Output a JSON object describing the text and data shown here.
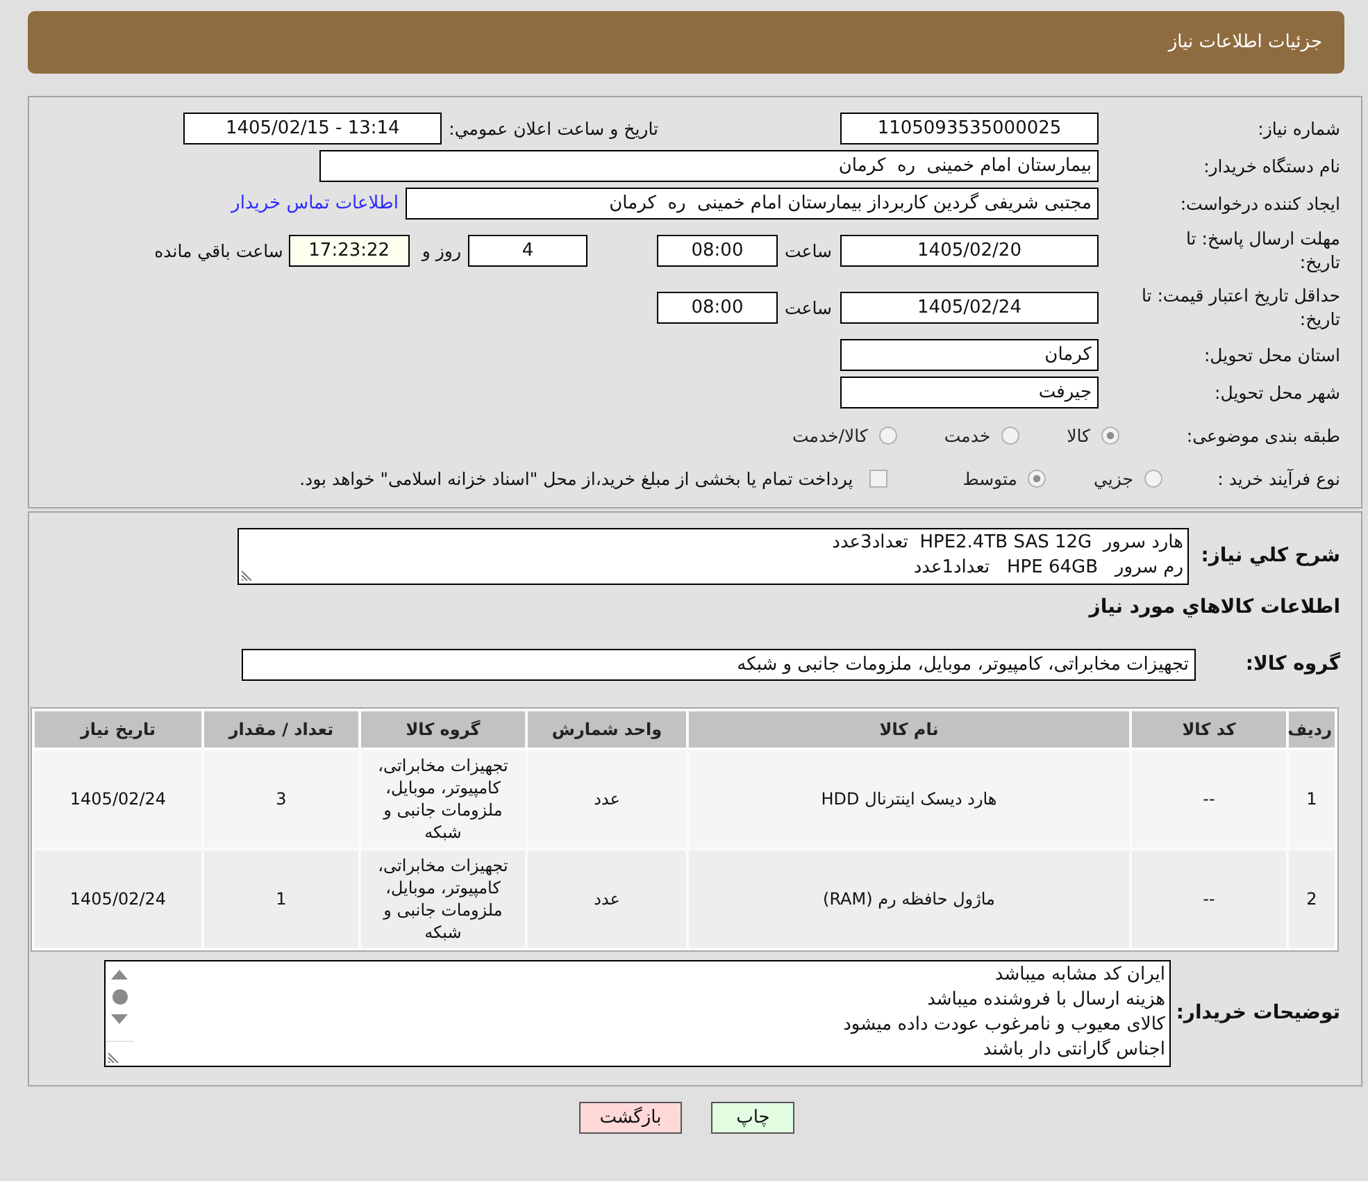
{
  "header": {
    "title": "جزئیات اطلاعات نیاز"
  },
  "details": {
    "need_number": {
      "label": "شماره نیاز:",
      "value": "1105093535000025"
    },
    "announcement": {
      "label": "تاریخ و ساعت اعلان عمومي:",
      "value": "1405/02/15 - 13:14"
    },
    "buyer_organization": {
      "label": "نام دستگاه خریدار:",
      "value": "بیمارستان امام خمینی  ره  کرمان"
    },
    "requester": {
      "label": "ایجاد کننده درخواست:",
      "value": "مجتبی شریفی گردین کاربرداز بیمارستان امام خمینی  ره  کرمان",
      "contact_link": "اطلاعات تماس خریدار"
    },
    "reply_deadline": {
      "label": "مهلت ارسال پاسخ: تا تاریخ:",
      "date": "1405/02/20",
      "time_label": "ساعت",
      "time": "08:00",
      "days": "4",
      "days_label": "روز و",
      "remaining": "17:23:22",
      "remaining_label": "ساعت باقي مانده"
    },
    "price_validity": {
      "label": "حداقل تاریخ اعتبار قیمت: تا تاریخ:",
      "date": "1405/02/24",
      "time_label": "ساعت",
      "time": "08:00"
    },
    "delivery_province": {
      "label": "استان محل تحویل:",
      "value": "کرمان"
    },
    "delivery_city": {
      "label": "شهر محل تحویل:",
      "value": "جیرفت"
    },
    "category": {
      "label": "طبقه بندی موضوعی:",
      "options": [
        {
          "label": "کالا",
          "selected": true
        },
        {
          "label": "خدمت",
          "selected": false
        },
        {
          "label": "کالا/خدمت",
          "selected": false
        }
      ]
    },
    "purchase_process": {
      "label": "نوع فرآیند خرید :",
      "options": [
        {
          "label": "جزيي",
          "selected": false
        },
        {
          "label": "متوسط",
          "selected": true
        }
      ],
      "treasury_payment": {
        "label": "پرداخت تمام یا بخشی از مبلغ خرید،از محل \"اسناد خزانه اسلامی\" خواهد بود.",
        "checked": false
      }
    }
  },
  "summary": {
    "label": "شرح کلي نیاز:",
    "lines": [
      "هارد سرور  HPE2.4TB SAS 12G  تعداد3عدد",
      "رم سرور   HPE 64GB   تعداد1عدد"
    ]
  },
  "goods": {
    "title": "اطلاعات کالاهاي مورد نیاز",
    "group": {
      "label": "گروه کالا:",
      "value": "تجهیزات مخابراتی، کامپیوتر، موبایل، ملزومات جانبی و شبکه"
    },
    "table": {
      "columns": [
        "ردیف",
        "کد کالا",
        "نام کالا",
        "واحد شمارش",
        "گروه کالا",
        "تعداد / مقدار",
        "تاریخ نیاز"
      ],
      "rows": [
        [
          "1",
          "--",
          "هارد دیسک اینترنال HDD",
          "عدد",
          "تجهیزات مخابراتی، کامپیوتر، موبایل، ملزومات جانبی و شبکه",
          "3",
          "1405/02/24"
        ],
        [
          "2",
          "--",
          "ماژول حافظه رم (RAM)",
          "عدد",
          "تجهیزات مخابراتی، کامپیوتر، موبایل، ملزومات جانبی و شبکه",
          "1",
          "1405/02/24"
        ]
      ]
    }
  },
  "buyer_notes": {
    "label": "توضیحات خریدار:",
    "lines": [
      "ایران کد مشابه میباشد",
      "هزینه ارسال با فروشنده میباشد",
      "کالای معیوب و نامرغوب عودت داده میشود",
      "اجناس گارانتی دار باشند"
    ]
  },
  "buttons": [
    {
      "label": "چاپ",
      "kind": "print"
    },
    {
      "label": "بازگشت",
      "kind": "back"
    }
  ]
}
